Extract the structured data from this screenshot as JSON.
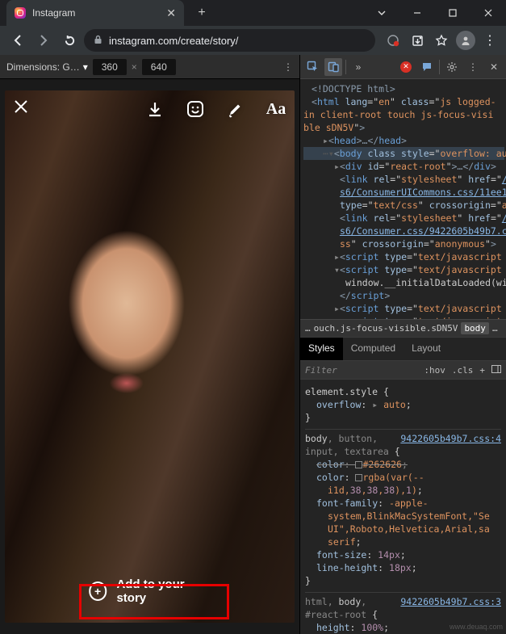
{
  "window": {
    "tab_title": "Instagram",
    "url": "instagram.com/create/story/"
  },
  "device": {
    "label": "Dimensions: G…",
    "w": "360",
    "h": "640"
  },
  "story": {
    "text_tool": "Aa",
    "add_label": "Add to your story"
  },
  "dom": {
    "l1": "<!DOCTYPE html>",
    "html_lang": "en",
    "html_class": "js logged-in client-root touch js-focus-visible sDN5V",
    "body_style": "overflow: aut",
    "react_root": "react-root",
    "rel": "stylesheet",
    "css1": "s6/ConsumerUICommons.css/11ee1",
    "typecss": "text/css",
    "co_a": "a",
    "css2": "s6/Consumer.css/9422605b49b7.c",
    "anon": "anonymous",
    "js": "text/javascript",
    "initdata": "window.__initialDataLoaded(wir"
  },
  "crumbs": {
    "c1": "…",
    "c2": "ouch.js-focus-visible.sDN5V",
    "c3": "body",
    "c4": "…"
  },
  "styles": {
    "tab_styles": "Styles",
    "tab_computed": "Computed",
    "tab_layout": "Layout",
    "filter_ph": "Filter",
    "hov": ":hov",
    "cls": ".cls"
  },
  "rules": {
    "es": "element.style",
    "overflow": "overflow",
    "auto": "auto",
    "sel2": "body, button, input, textarea",
    "file2": "9422605b49b7.css:4",
    "color_old": "#262626",
    "rgba": "rgba(var(--i1d,38,38,38),1)",
    "ff": "-apple-system,BlinkMacSystemFont,\"Segoe UI\",Roboto,Helvetica,Arial,sans-serif",
    "fs14": "14px",
    "lh18": "18px",
    "sel3": "html, body, #react-root",
    "file3": "9422605b49b7.css:3",
    "h100": "100%"
  },
  "watermark": "www.deuaq.com"
}
